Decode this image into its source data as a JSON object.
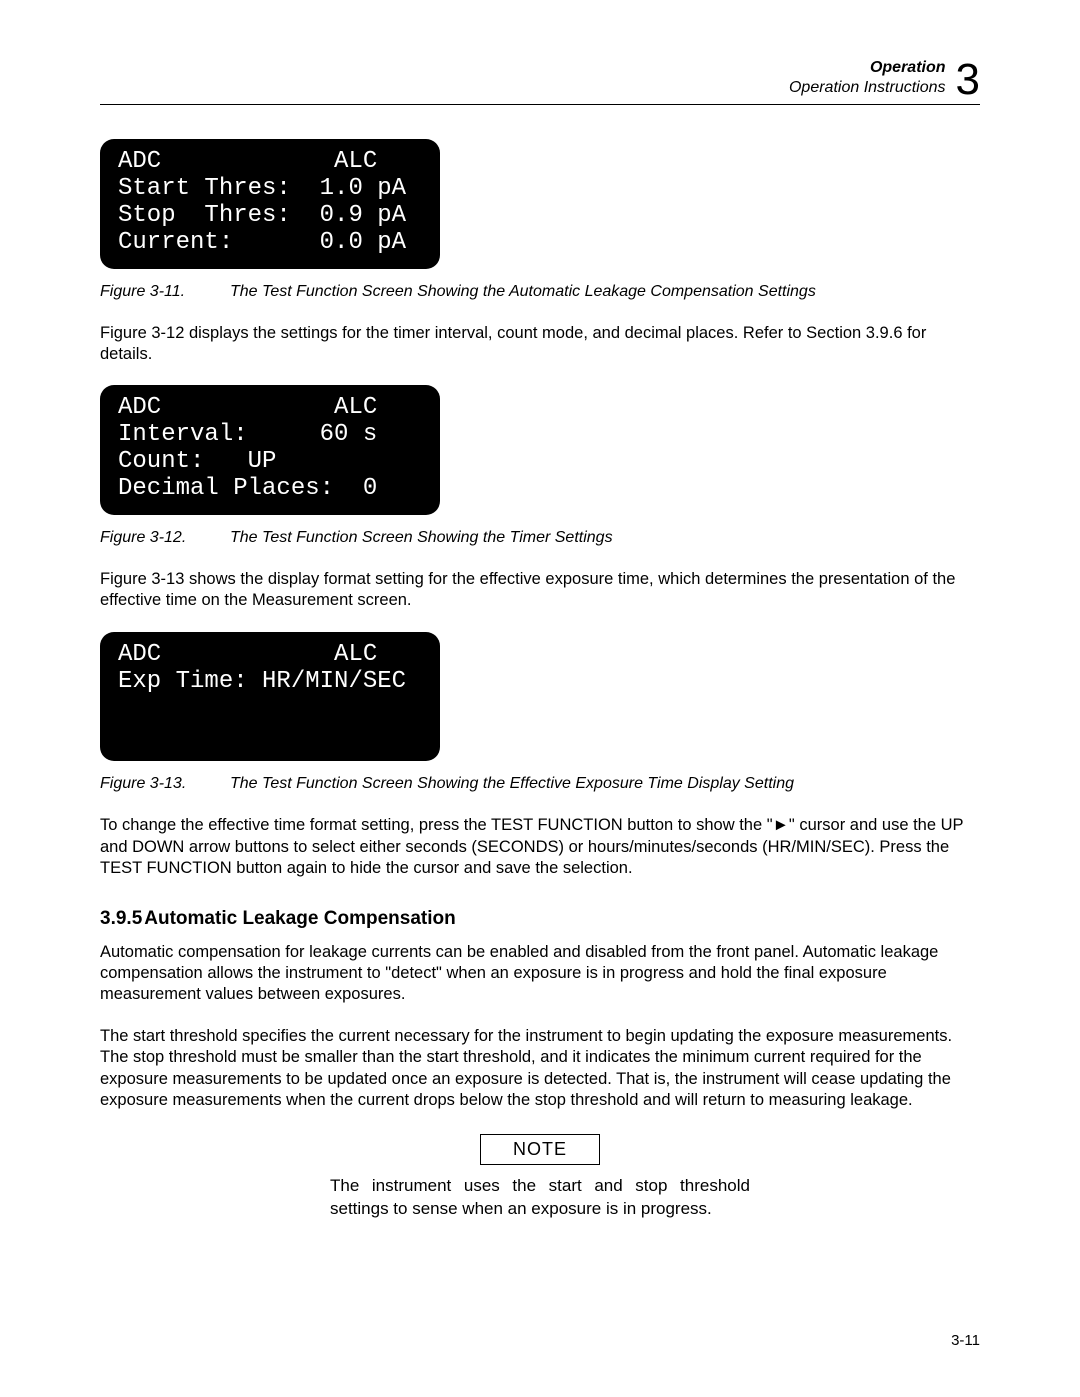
{
  "header": {
    "title": "Operation",
    "subtitle": "Operation Instructions",
    "chapter": "3"
  },
  "lcd1": {
    "l1": "ADC            ALC",
    "l2": "Start Thres:  1.0 pA",
    "l3": "Stop  Thres:  0.9 pA",
    "l4": "Current:      0.0 pA"
  },
  "caption1": {
    "label": "Figure 3-11.",
    "text": "The Test Function Screen Showing the Automatic Leakage Compensation Settings"
  },
  "para1": "Figure 3-12 displays the settings for the timer interval, count mode, and decimal places.  Refer to Section 3.9.6 for details.",
  "lcd2": {
    "l1": "ADC            ALC",
    "l2": "Interval:     60 s",
    "l3": "Count:   UP",
    "l4": "Decimal Places:  0"
  },
  "caption2": {
    "label": "Figure 3-12.",
    "text": "The Test Function Screen Showing the Timer Settings"
  },
  "para2": "Figure 3-13 shows the display format setting for the effective exposure time, which determines the presentation of the effective time on the Measurement screen.",
  "lcd3": {
    "l1": "ADC            ALC",
    "l2": "Exp Time: HR/MIN/SEC",
    "l3": " ",
    "l4": " "
  },
  "caption3": {
    "label": "Figure 3-13.",
    "text": "The Test Function Screen Showing the Effective Exposure Time Display Setting"
  },
  "para3": "To change the effective time format setting, press the TEST FUNCTION button to show the \"►\" cursor and use the UP and DOWN arrow buttons to select either seconds (SECONDS) or hours/minutes/seconds (HR/MIN/SEC).   Press the TEST FUNCTION button again to hide the cursor and save the selection.",
  "section": {
    "number": "3.9.5",
    "title": "Automatic Leakage Compensation"
  },
  "para4": "Automatic compensation for leakage currents can be enabled and disabled from the front panel.  Automatic leakage compensation allows the instrument to \"detect\" when an exposure is in progress and hold the final exposure measurement values between exposures.",
  "para5": "The start threshold specifies the current necessary for the instrument to begin updating the exposure measurements.  The stop threshold must be smaller than the start threshold, and it indicates the minimum current required for the exposure measurements to be updated once an exposure is detected.  That is, the instrument will cease updating the exposure measurements when the current drops below the stop threshold and will return to measuring leakage.",
  "note": {
    "label": "NOTE",
    "text": "The instrument uses the start and stop threshold settings to sense when an exposure is in progress."
  },
  "page_number": "3-11"
}
